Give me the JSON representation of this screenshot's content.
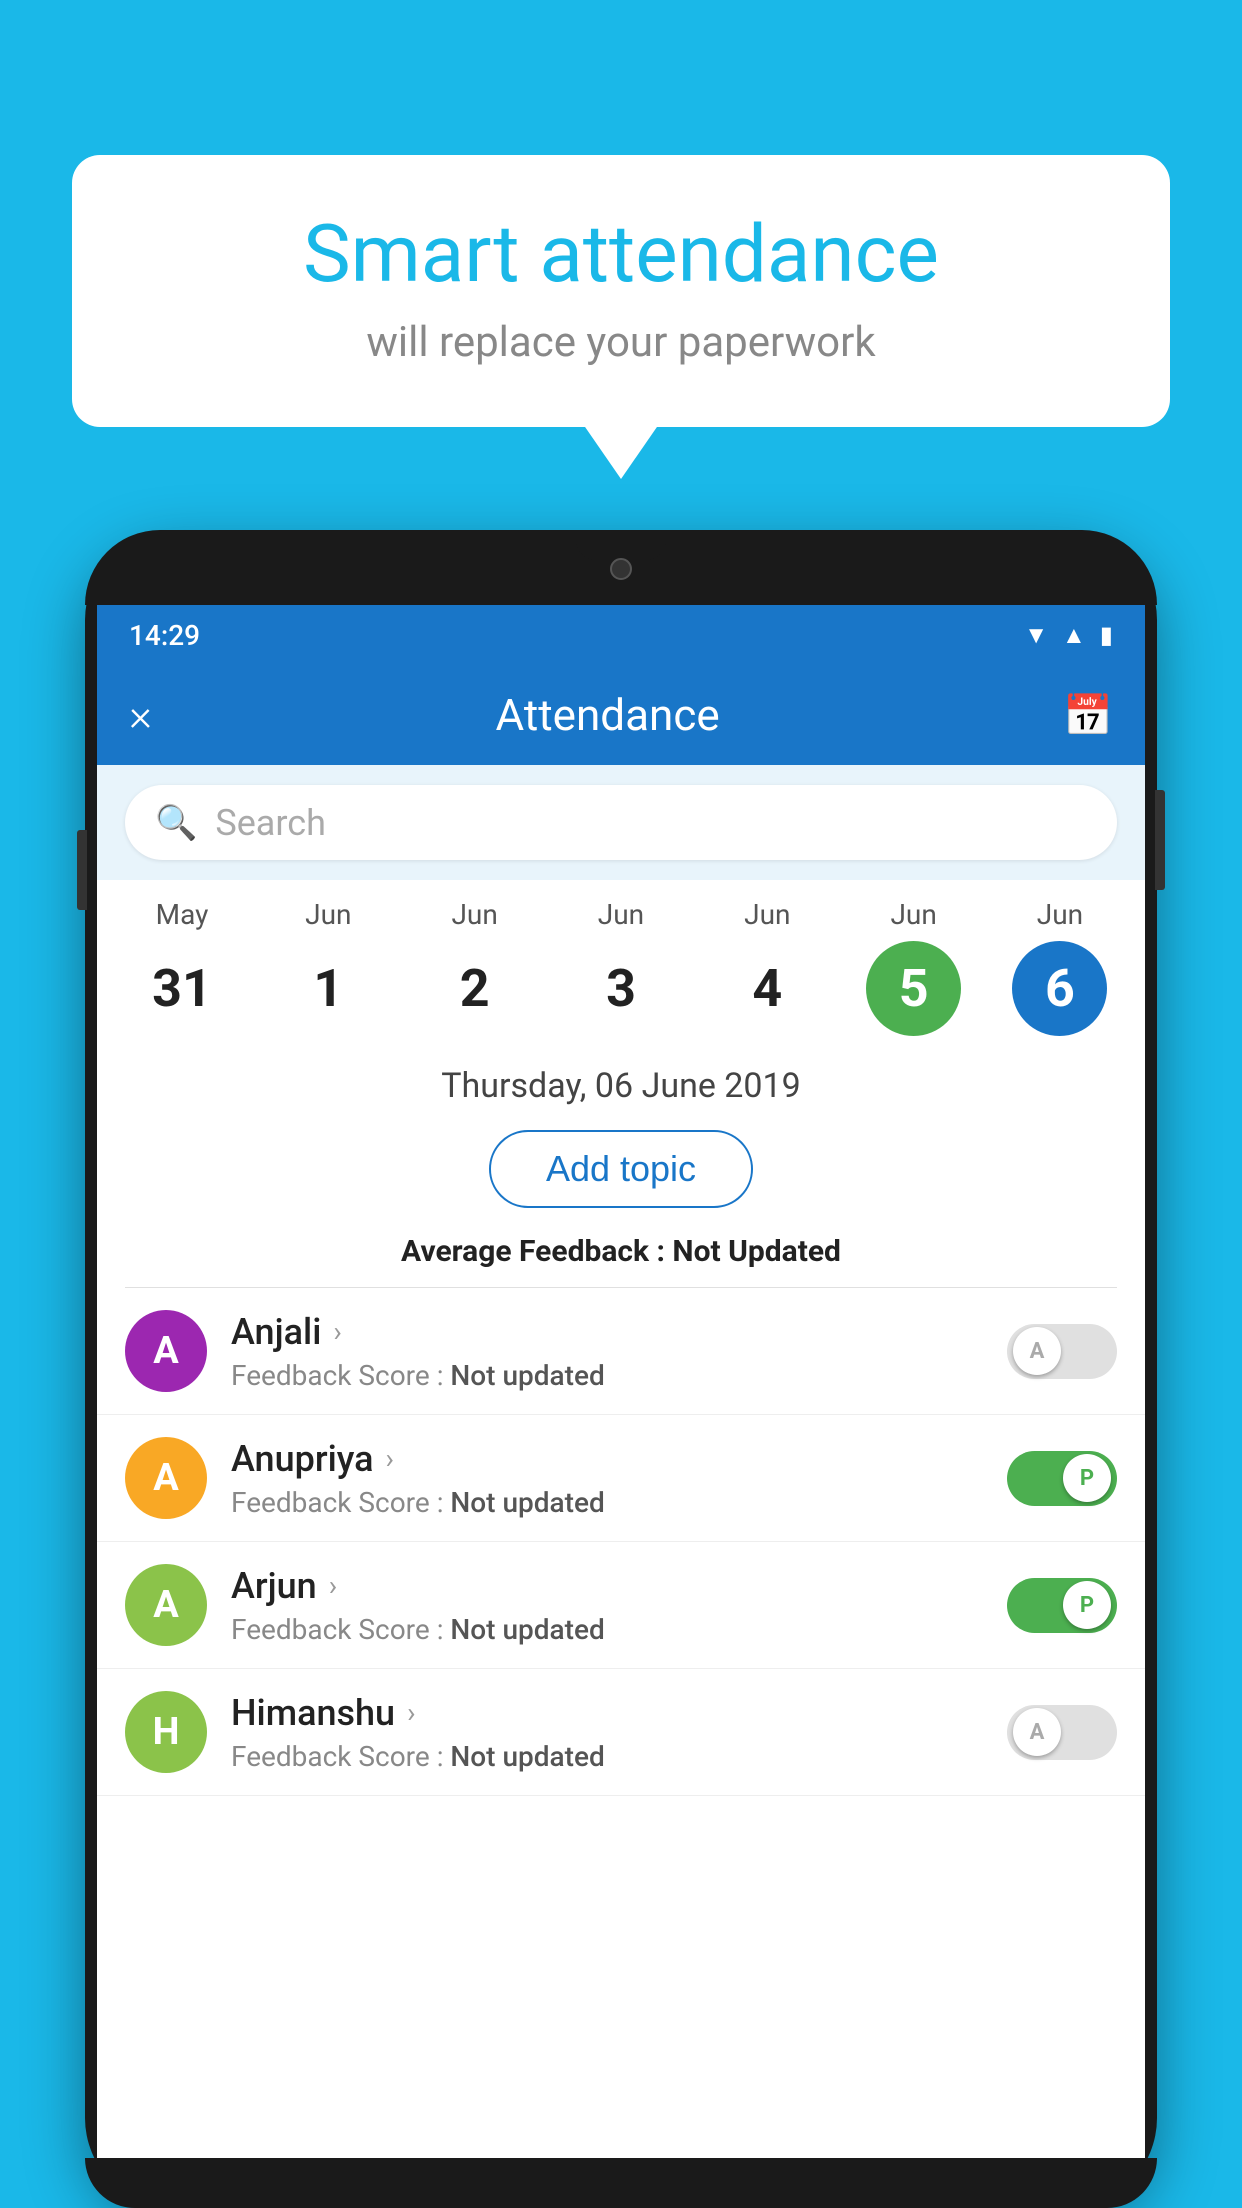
{
  "background_color": "#1ab8e8",
  "speech_bubble": {
    "title": "Smart attendance",
    "subtitle": "will replace your paperwork"
  },
  "status_bar": {
    "time": "14:29",
    "icons": [
      "wifi",
      "signal",
      "battery"
    ]
  },
  "app_bar": {
    "title": "Attendance",
    "close_label": "×",
    "calendar_icon": "📅"
  },
  "search": {
    "placeholder": "Search"
  },
  "calendar": {
    "days": [
      {
        "month": "May",
        "date": "31",
        "state": "normal"
      },
      {
        "month": "Jun",
        "date": "1",
        "state": "normal"
      },
      {
        "month": "Jun",
        "date": "2",
        "state": "normal"
      },
      {
        "month": "Jun",
        "date": "3",
        "state": "normal"
      },
      {
        "month": "Jun",
        "date": "4",
        "state": "normal"
      },
      {
        "month": "Jun",
        "date": "5",
        "state": "today"
      },
      {
        "month": "Jun",
        "date": "6",
        "state": "selected"
      }
    ]
  },
  "selected_date_label": "Thursday, 06 June 2019",
  "add_topic_label": "Add topic",
  "average_feedback_label": "Average Feedback :",
  "average_feedback_value": "Not Updated",
  "students": [
    {
      "name": "Anjali",
      "avatar_letter": "A",
      "avatar_color": "#9c27b0",
      "feedback_label": "Feedback Score :",
      "feedback_value": "Not updated",
      "attendance": "absent"
    },
    {
      "name": "Anupriya",
      "avatar_letter": "A",
      "avatar_color": "#f9a825",
      "feedback_label": "Feedback Score :",
      "feedback_value": "Not updated",
      "attendance": "present"
    },
    {
      "name": "Arjun",
      "avatar_letter": "A",
      "avatar_color": "#8bc34a",
      "feedback_label": "Feedback Score :",
      "feedback_value": "Not updated",
      "attendance": "present"
    },
    {
      "name": "Himanshu",
      "avatar_letter": "H",
      "avatar_color": "#8bc34a",
      "feedback_label": "Feedback Score :",
      "feedback_value": "Not updated",
      "attendance": "absent"
    }
  ]
}
